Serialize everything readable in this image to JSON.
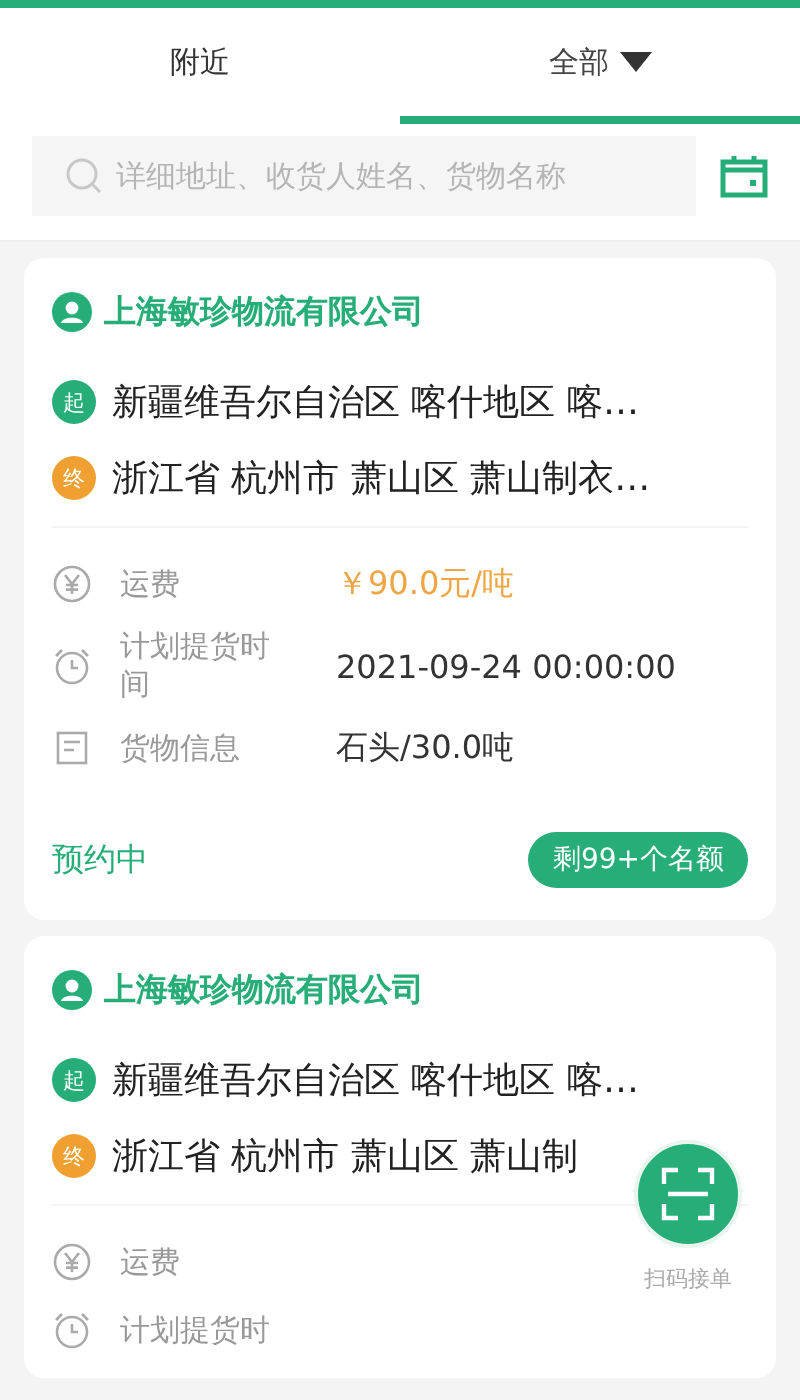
{
  "tabs": [
    {
      "label": "附近",
      "selected": false,
      "has_menu": false
    },
    {
      "label": "全部",
      "selected": true,
      "has_menu": true
    }
  ],
  "search": {
    "placeholder": "详细地址、收货人姓名、货物名称"
  },
  "orders": [
    {
      "company": "上海敏珍物流有限公司",
      "origin": {
        "badge": "起",
        "address": "新疆维吾尔自治区 喀什地区 喀…"
      },
      "destination": {
        "badge": "终",
        "address": "浙江省 杭州市 萧山区 萧山制衣…"
      },
      "details": [
        {
          "kind": "fee",
          "label": "运费",
          "value": "￥90.0元/吨"
        },
        {
          "kind": "time",
          "label": "计划提货时间",
          "value": "2021-09-24 00:00:00"
        },
        {
          "kind": "cargo",
          "label": "货物信息",
          "value": "石头/30.0吨"
        }
      ],
      "status": "预约中",
      "quota": "剩99+个名额"
    },
    {
      "company": "上海敏珍物流有限公司",
      "origin": {
        "badge": "起",
        "address": "新疆维吾尔自治区 喀什地区 喀…"
      },
      "destination": {
        "badge": "终",
        "address": "浙江省 杭州市 萧山区 萧山制"
      },
      "details": [
        {
          "kind": "fee",
          "label": "运费"
        },
        {
          "kind": "time",
          "label": "计划提货时"
        }
      ]
    }
  ],
  "scan_button": {
    "label": "扫码接单"
  }
}
